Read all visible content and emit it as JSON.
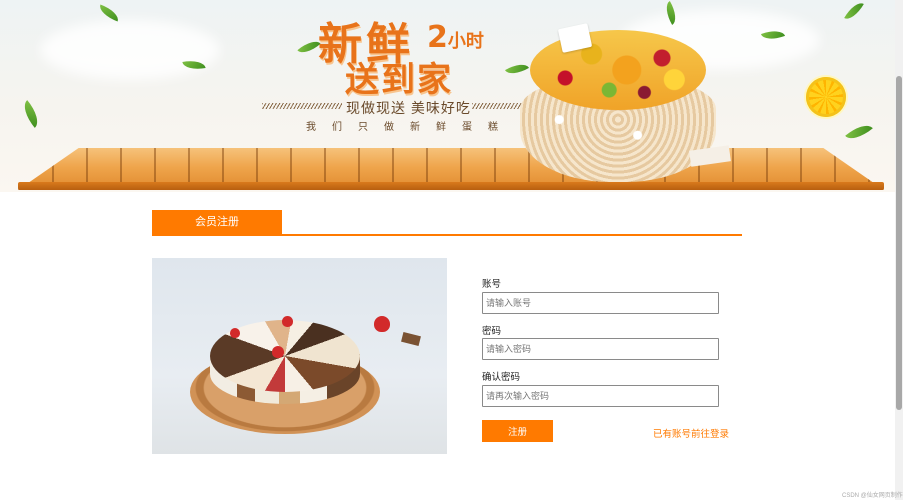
{
  "banner": {
    "title_line1": "新鲜",
    "title_line2": "送到家",
    "badge_number": "2",
    "badge_unit": "小时",
    "slogan": "现做现送 美味好吃",
    "subtitle": "我们只做新鲜蛋糕"
  },
  "registration": {
    "tab_label": "会员注册",
    "account": {
      "label": "账号",
      "placeholder": "请输入账号",
      "value": ""
    },
    "password": {
      "label": "密码",
      "placeholder": "请输入密码",
      "value": ""
    },
    "confirm_password": {
      "label": "确认密码",
      "placeholder": "请再次输入密码",
      "value": ""
    },
    "submit_label": "注册",
    "login_link": "已有账号前往登录"
  },
  "footer": {
    "watermark": "CSDN @仙女网页制作"
  },
  "colors": {
    "accent": "#ff7a00",
    "banner_text": "#e8731a"
  },
  "icons": [
    "lemon-slice",
    "leaf",
    "cake-photo"
  ]
}
